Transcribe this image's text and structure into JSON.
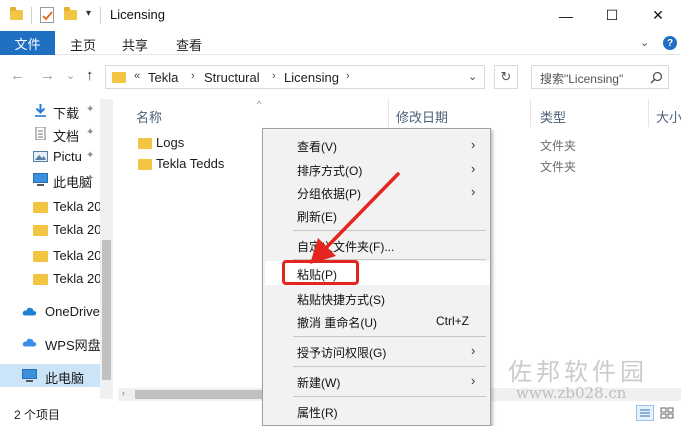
{
  "window": {
    "title": "Licensing",
    "quick_access_dropdown": "▾",
    "minimize": "—",
    "maximize": "☐",
    "close": "✕"
  },
  "ribbon": {
    "tabs": [
      "文件",
      "主页",
      "共享",
      "查看"
    ],
    "expand_chevron": "⌄",
    "help": "?"
  },
  "nav": {
    "back": "←",
    "forward": "→",
    "recent": "⌄",
    "up": "↑",
    "breadcrumb_overflow": "«",
    "breadcrumbs": [
      "Tekla",
      "Structural",
      "Licensing"
    ],
    "address_dropdown": "⌄",
    "refresh": "↻",
    "search_placeholder": "搜索\"Licensing\""
  },
  "sidebar": {
    "items": [
      {
        "label": "下载",
        "icon": "download-icon",
        "pinned": true
      },
      {
        "label": "文档",
        "icon": "document-icon",
        "pinned": true
      },
      {
        "label": "Pictu",
        "icon": "pictures-icon",
        "pinned": true
      },
      {
        "label": "此电脑",
        "icon": "computer-icon",
        "pinned": true
      },
      {
        "label": "Tekla 20",
        "icon": "folder-icon",
        "pinned": false
      },
      {
        "label": "Tekla 20",
        "icon": "folder-icon",
        "pinned": false
      },
      {
        "label": "Tekla 20",
        "icon": "folder-icon",
        "pinned": false
      },
      {
        "label": "Tekla 20",
        "icon": "folder-icon",
        "pinned": false
      },
      {
        "label": "OneDrive",
        "icon": "cloud-icon",
        "pinned": false
      },
      {
        "label": "WPS网盘",
        "icon": "cloud-icon",
        "pinned": false
      },
      {
        "label": "此电脑",
        "icon": "computer-icon",
        "pinned": false,
        "selected": true
      }
    ],
    "pin_glyph": "📌"
  },
  "filelist": {
    "columns": [
      "名称",
      "修改日期",
      "类型",
      "大小"
    ],
    "sort_glyph": "^",
    "rows": [
      {
        "name": "Logs",
        "type": "文件夹"
      },
      {
        "name": "Tekla Tedds",
        "type": "文件夹"
      }
    ]
  },
  "status": {
    "item_count": "2 个项目"
  },
  "context_menu": {
    "items": [
      {
        "label": "查看(V)",
        "submenu": true
      },
      {
        "label": "排序方式(O)",
        "submenu": true
      },
      {
        "label": "分组依据(P)",
        "submenu": true
      },
      {
        "label": "刷新(E)",
        "submenu": false
      },
      {
        "label": "自定义文件夹(F)...",
        "submenu": false
      },
      {
        "label": "粘贴(P)",
        "submenu": false
      },
      {
        "label": "粘贴快捷方式(S)",
        "submenu": false
      },
      {
        "label": "撤消 重命名(U)",
        "submenu": false,
        "shortcut": "Ctrl+Z"
      },
      {
        "label": "授予访问权限(G)",
        "submenu": true
      },
      {
        "label": "新建(W)",
        "submenu": true
      },
      {
        "label": "属性(R)",
        "submenu": false
      }
    ],
    "submenu_glyph": "›"
  },
  "watermark": {
    "text": "佐邦软件园",
    "url": "www.zb028.cn"
  },
  "colors": {
    "accent": "#1f6fc3",
    "selection": "#cce4f7",
    "highlight_red": "#e5251f",
    "folder": "#f3c545"
  }
}
